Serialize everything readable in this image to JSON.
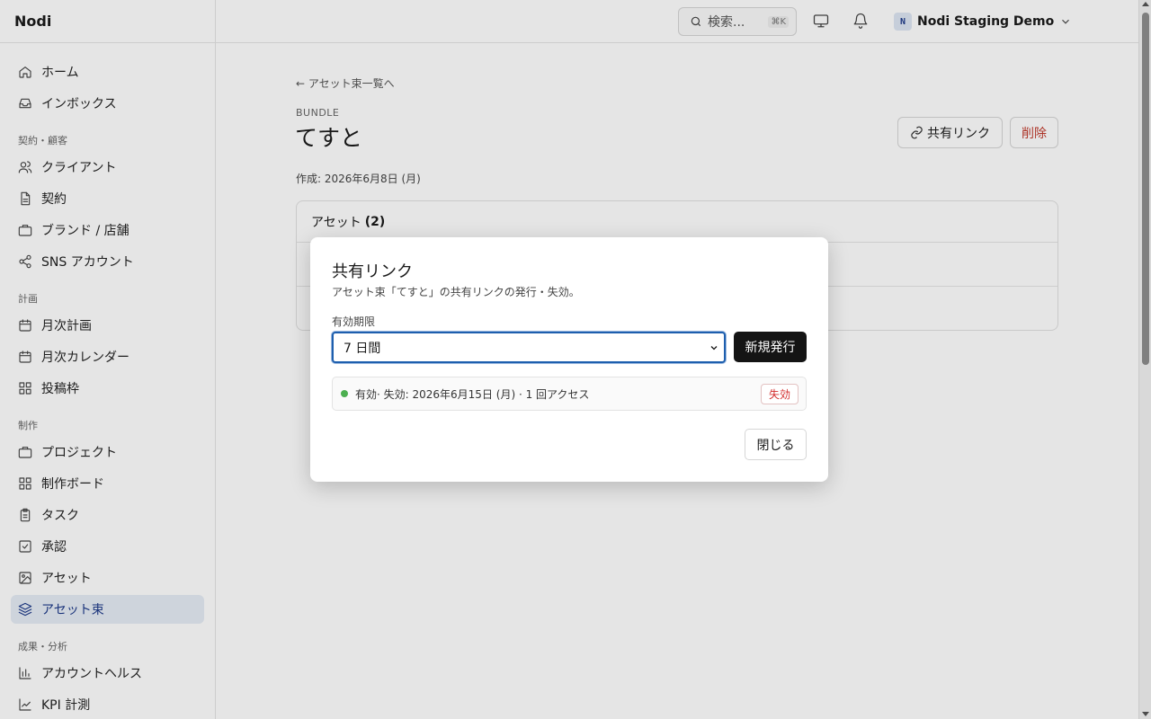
{
  "app": {
    "brand": "Nodi"
  },
  "topbar": {
    "search_placeholder": "検索...",
    "search_shortcut": "⌘K",
    "workspace_initial": "N",
    "workspace_name": "Nodi Staging Demo"
  },
  "sidebar": {
    "items_top": [
      {
        "label": "ホーム",
        "icon": "home-icon"
      },
      {
        "label": "インボックス",
        "icon": "inbox-icon"
      }
    ],
    "section_contract": "契約・顧客",
    "items_contract": [
      {
        "label": "クライアント",
        "icon": "users-icon"
      },
      {
        "label": "契約",
        "icon": "file-icon"
      },
      {
        "label": "ブランド / 店舗",
        "icon": "briefcase-icon"
      },
      {
        "label": "SNS アカウント",
        "icon": "share-icon"
      }
    ],
    "section_plan": "計画",
    "items_plan": [
      {
        "label": "月次計画",
        "icon": "calendar-icon"
      },
      {
        "label": "月次カレンダー",
        "icon": "calendar-icon"
      },
      {
        "label": "投稿枠",
        "icon": "grid-icon"
      }
    ],
    "section_production": "制作",
    "items_production": [
      {
        "label": "プロジェクト",
        "icon": "briefcase-icon"
      },
      {
        "label": "制作ボード",
        "icon": "grid-icon"
      },
      {
        "label": "タスク",
        "icon": "clipboard-icon"
      },
      {
        "label": "承認",
        "icon": "check-square-icon"
      },
      {
        "label": "アセット",
        "icon": "image-icon"
      },
      {
        "label": "アセット束",
        "icon": "layers-icon",
        "active": true
      }
    ],
    "section_analytics": "成果・分析",
    "items_analytics": [
      {
        "label": "アカウントヘルス",
        "icon": "bar-chart-icon"
      },
      {
        "label": "KPI 計測",
        "icon": "line-chart-icon"
      }
    ]
  },
  "page": {
    "back_link": "← アセット束一覧へ",
    "kicker": "BUNDLE",
    "title": "てすと",
    "share_button": "共有リンク",
    "delete_button": "削除",
    "created": "作成: 2026年6月8日 (月)",
    "assets_label": "アセット",
    "assets_count": "(2)"
  },
  "modal": {
    "title": "共有リンク",
    "description": "アセット束「てすと」の共有リンクの発行・失効。",
    "expiry_label": "有効期限",
    "expiry_selected": "7 日間",
    "issue_button": "新規発行",
    "link_status": "有効",
    "link_detail": " · 失効: 2026年6月15日 (月) · 1 回アクセス",
    "revoke_button": "失効",
    "close_button": "閉じる"
  },
  "colors": {
    "active_nav_bg": "#e6ecf5",
    "accent": "#1e3a8a",
    "danger": "#d32f2f",
    "success_dot": "#4caf50",
    "primary_button": "#141414"
  }
}
